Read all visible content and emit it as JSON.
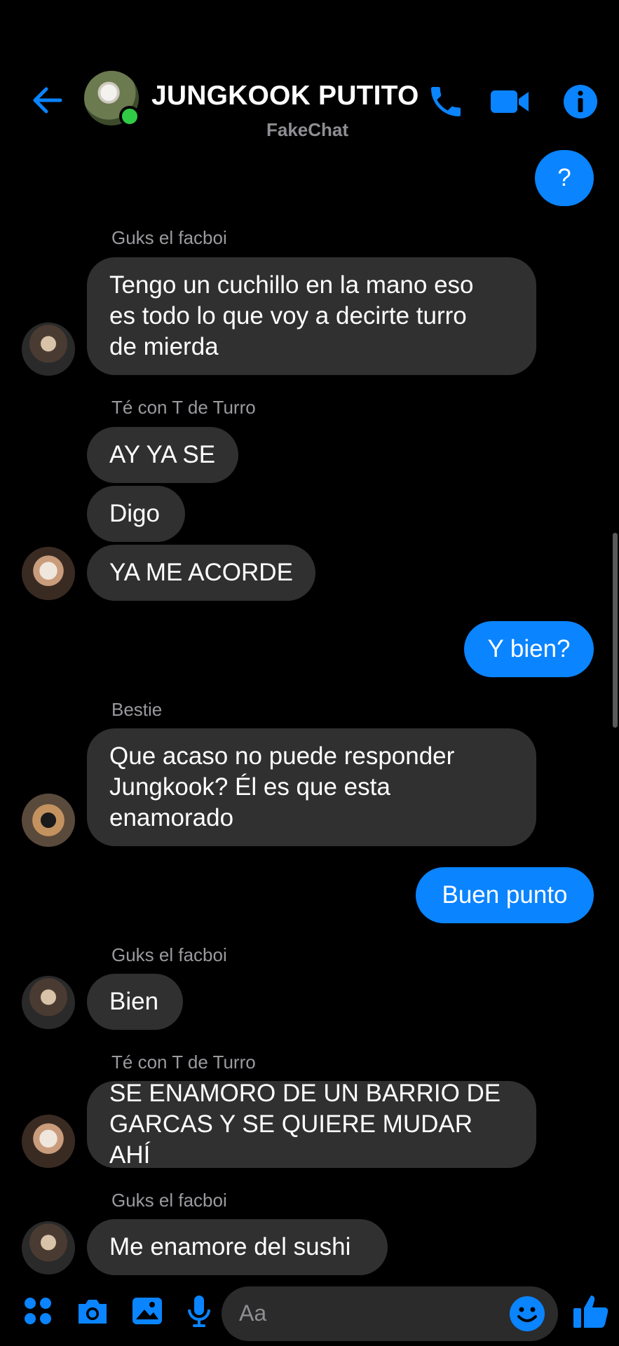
{
  "header": {
    "title": "JUNGKOOK PUTITO",
    "subtitle": "FakeChat",
    "icons": [
      "back-arrow-icon",
      "phone-icon",
      "video-camera-icon",
      "info-icon"
    ],
    "accent": "#0a84ff"
  },
  "messages": [
    {
      "type": "out",
      "text": "?"
    },
    {
      "sender": "Guks el facboi",
      "lines": [
        "Tengo un cuchillo en la mano eso",
        "es todo lo que voy a decirte turro",
        "de mierda"
      ]
    },
    {
      "sender": "Té con T de Turro",
      "texts": [
        "AY YA SE",
        "Digo",
        "YA ME ACORDE"
      ]
    },
    {
      "type": "out",
      "text": "Y bien?"
    },
    {
      "sender": "Bestie",
      "lines": [
        "Que acaso no puede responder",
        "Jungkook? Él es que esta",
        "enamorado"
      ]
    },
    {
      "type": "out",
      "text": "Buen punto"
    },
    {
      "sender": "Guks el facboi",
      "text": "Bien"
    },
    {
      "sender": "Té con T de Turro",
      "lines": [
        "SE ENAMORO DE UN BARRIO DE",
        "GARCAS Y SE QUIERE MUDAR AHÍ"
      ]
    },
    {
      "sender": "Guks el facboi",
      "text": "Me enamore del sushi"
    }
  ],
  "composer": {
    "placeholder": "Aa",
    "icons": [
      "apps-grid-icon",
      "camera-icon",
      "gallery-icon",
      "microphone-icon",
      "emoji-icon",
      "thumbs-up-icon"
    ]
  }
}
